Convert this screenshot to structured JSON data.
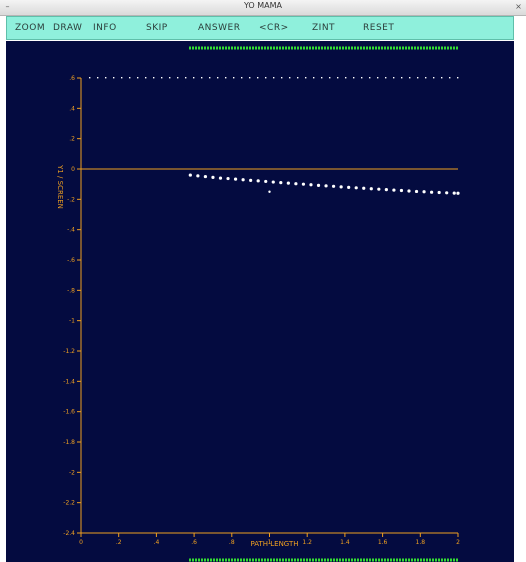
{
  "window": {
    "title": "YO MAMA",
    "close_glyph": "×",
    "menu_glyph": "–"
  },
  "menu": {
    "items": [
      "ZOOM",
      "DRAW",
      "INFO",
      "SKIP",
      "ANSWER",
      "<CR>",
      "ZINT",
      "RESET"
    ]
  },
  "colors": {
    "plot_background": "#040b40",
    "axis": "#f0a020",
    "points": "#ffffff",
    "menu_background": "#8ff0dc",
    "marker_band": "#33dd33"
  },
  "chart_data": {
    "type": "scatter",
    "xlabel": "PATH LENGTH",
    "ylabel": "Y1 / SCREEN",
    "xlim": [
      0,
      2
    ],
    "ylim": [
      -2.4,
      0.6
    ],
    "x_ticks": [
      0,
      0.2,
      0.4,
      0.6,
      0.8,
      1.0,
      1.2,
      1.4,
      1.6,
      1.8,
      2.0
    ],
    "x_tick_labels": [
      "0",
      ".2",
      ".4",
      ".6",
      ".8",
      "1",
      "1.2",
      "1.4",
      "1.6",
      "1.8",
      "2"
    ],
    "y_ticks": [
      0.6,
      0.4,
      0.2,
      0,
      -0.2,
      -0.4,
      -0.6,
      -0.8,
      -1.0,
      -1.2,
      -1.4,
      -1.6,
      -1.8,
      -2.0,
      -2.2,
      -2.4
    ],
    "y_tick_labels": [
      ".6",
      ".4",
      ".2",
      "0",
      "-.2",
      "-.4",
      "-.6",
      "-.8",
      "-1",
      "-1.2",
      "-1.4",
      "-1.6",
      "-1.8",
      "-2",
      "-2.2",
      "-2.4"
    ],
    "reference_line_y": 0,
    "series": [
      {
        "x": [
          0.58,
          0.62,
          0.66,
          0.7,
          0.74,
          0.78,
          0.82,
          0.86,
          0.9,
          0.94,
          0.98,
          1.02,
          1.06,
          1.1,
          1.14,
          1.18,
          1.22,
          1.26,
          1.3,
          1.34,
          1.38,
          1.42,
          1.46,
          1.5,
          1.54,
          1.58,
          1.62,
          1.66,
          1.7,
          1.74,
          1.78,
          1.82,
          1.86,
          1.9,
          1.94,
          1.98,
          2.0
        ],
        "y": [
          -0.04,
          -0.045,
          -0.05,
          -0.055,
          -0.06,
          -0.063,
          -0.067,
          -0.071,
          -0.075,
          -0.078,
          -0.082,
          -0.086,
          -0.09,
          -0.093,
          -0.097,
          -0.1,
          -0.104,
          -0.108,
          -0.111,
          -0.114,
          -0.118,
          -0.121,
          -0.124,
          -0.127,
          -0.13,
          -0.133,
          -0.136,
          -0.139,
          -0.142,
          -0.145,
          -0.148,
          -0.15,
          -0.153,
          -0.155,
          -0.157,
          -0.159,
          -0.16
        ]
      }
    ],
    "isolated_points": [
      {
        "x": 1.0,
        "y": -0.15
      }
    ]
  }
}
